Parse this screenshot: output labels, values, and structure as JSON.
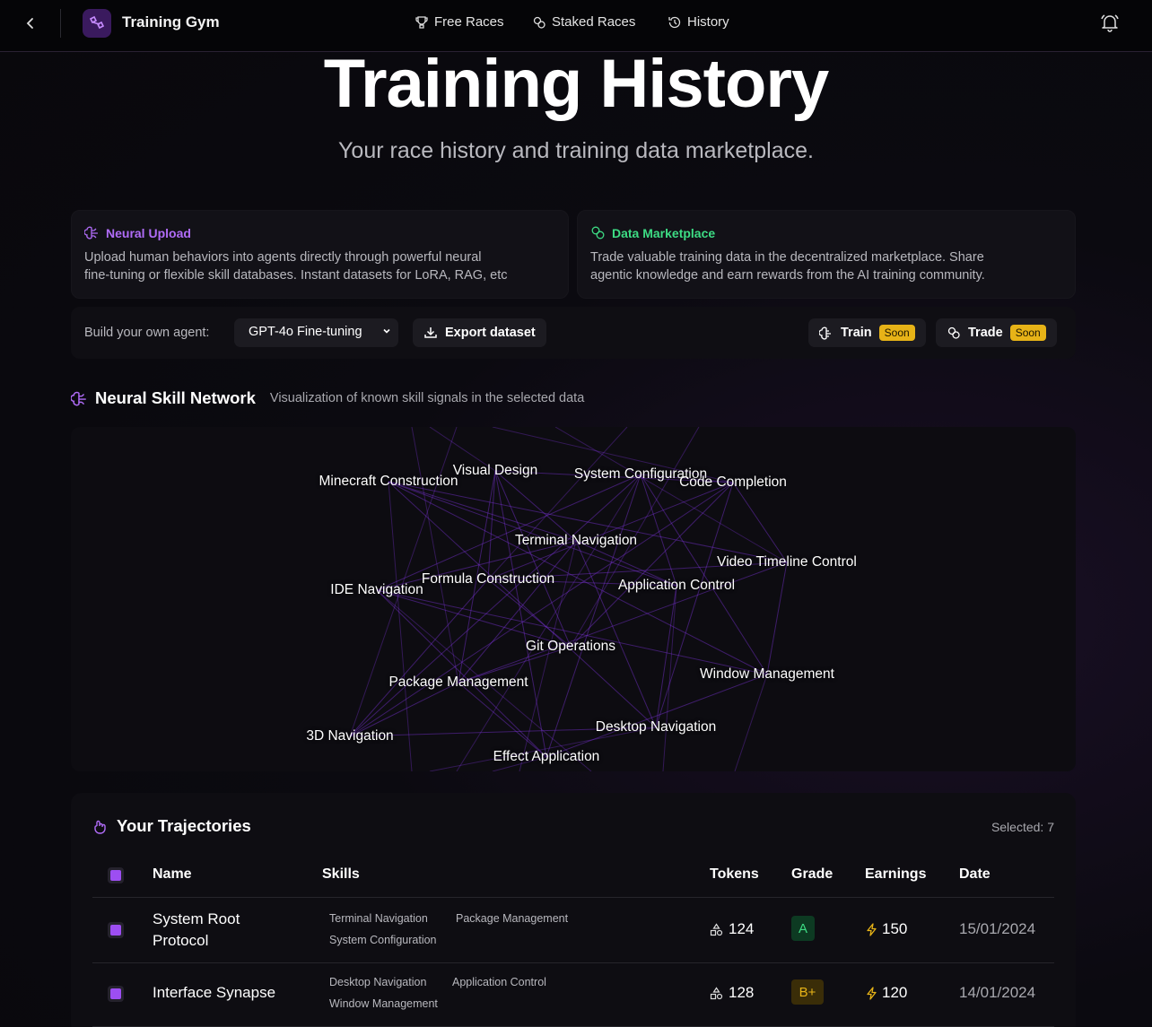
{
  "app": {
    "name": "Training Gym"
  },
  "nav": [
    {
      "label": "Free Races",
      "icon": "trophy-icon"
    },
    {
      "label": "Staked Races",
      "icon": "coins-icon"
    },
    {
      "label": "History",
      "icon": "history-icon"
    }
  ],
  "hero": {
    "title": "Training History",
    "subtitle": "Your race history and training data marketplace."
  },
  "cards": {
    "neural": {
      "title": "Neural Upload",
      "text1": "Upload human behaviors into agents directly through powerful neural",
      "text2": "fine-tuning or flexible skill databases. Instant datasets for LoRA, RAG, etc",
      "color": "#b06cf7"
    },
    "market": {
      "title": "Data Marketplace",
      "text1": "Trade valuable training data in the decentralized marketplace. Share",
      "text2": "agentic knowledge and earn rewards from the AI training community.",
      "color": "#3ddc84"
    }
  },
  "toolbar": {
    "build_label": "Build your own agent:",
    "select_value": "GPT-4o Fine-tuning",
    "export_label": "Export dataset",
    "train_label": "Train",
    "trade_label": "Trade",
    "soon_label": "Soon"
  },
  "network": {
    "title": "Neural Skill Network",
    "description": "Visualization of known skill signals in the selected data",
    "nodes": [
      "Minecraft Construction",
      "Visual Design",
      "System Configuration",
      "Code Completion",
      "Terminal Navigation",
      "Video Timeline Control",
      "IDE Navigation",
      "Formula Construction",
      "Application Control",
      "Git Operations",
      "Window Management",
      "Package Management",
      "Desktop Navigation",
      "3D Navigation",
      "Effect Application"
    ]
  },
  "trajectories": {
    "title": "Your Trajectories",
    "selected": "Selected: 7",
    "headers": {
      "name": "Name",
      "skills": "Skills",
      "tokens": "Tokens",
      "grade": "Grade",
      "earnings": "Earnings",
      "date": "Date"
    },
    "rows": [
      {
        "name1": "System Root",
        "name2": "Protocol",
        "skills": [
          "Terminal Navigation",
          "Package Management",
          "System Configuration"
        ],
        "tokens": "124",
        "grade": "A",
        "earnings": "150",
        "date": "15/01/2024"
      },
      {
        "name1": "Interface Synapse",
        "name2": "",
        "skills": [
          "Desktop Navigation",
          "Application Control",
          "Window Management"
        ],
        "tokens": "128",
        "grade": "B+",
        "earnings": "120",
        "date": "14/01/2024"
      }
    ]
  },
  "colors": {
    "accent": "#9d4ef2",
    "soon": "#e7b317",
    "gradeA": "#3ddc84",
    "gradeB": "#e7b317"
  }
}
